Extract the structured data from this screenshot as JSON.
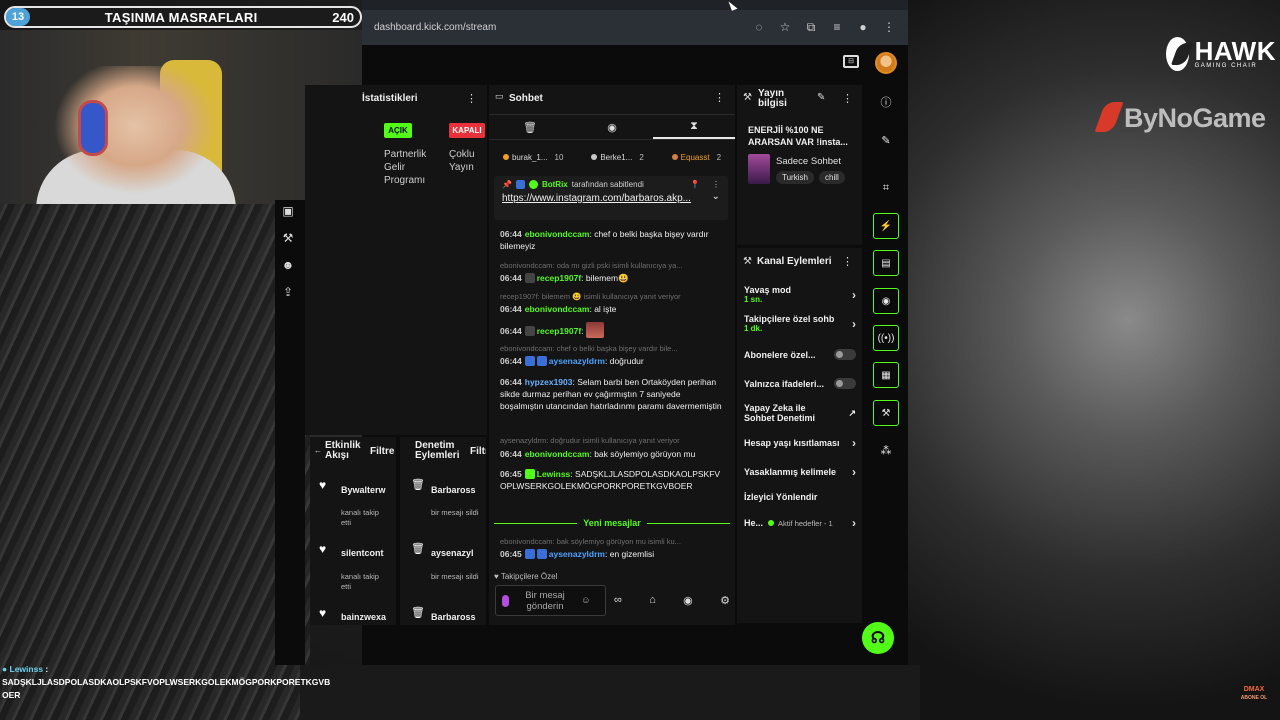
{
  "overlay": {
    "goal_count": "13",
    "goal_title": "TAŞINMA MASRAFLARI",
    "goal_value": "240"
  },
  "browser": {
    "url": "dashboard.kick.com/stream"
  },
  "stats": {
    "title": "İstatistikleri",
    "badge_on": "AÇIK",
    "badge_off": "KAPALI",
    "partner_label": "Partnerlik Gelir Programı",
    "multistream_label": "Çoklu Yayın"
  },
  "chat": {
    "title": "Sohbet",
    "top_chatters": [
      {
        "name": "burak_1...",
        "count": "10",
        "color": "#f0a020"
      },
      {
        "name": "Berke1...",
        "count": "2",
        "color": "#c8c8c8"
      },
      {
        "name": "Equasst",
        "count": "2",
        "color": "#d08040"
      }
    ],
    "pinned": {
      "user": "BotRix",
      "label": "tarafından sabitlendi",
      "link": "https://www.instagram.com/barbaros.akp..."
    },
    "messages": [
      {
        "time": "06:44",
        "user": "ebonivondccam",
        "color": "#53fc18",
        "text": "chef o belki başka bişey vardır bilemeyiz"
      },
      {
        "reply": "ebonivondccam: oda mı gizli pski isimli kullanıcıya ya..."
      },
      {
        "time": "06:44",
        "user": "recep1907f",
        "color": "#53fc18",
        "text": "bilemem😃"
      },
      {
        "reply": "recep1907f: bilemem 😃 isimli kullanıcıya yanıt veriyor"
      },
      {
        "time": "06:44",
        "user": "ebonivondccam",
        "color": "#53fc18",
        "text": "al işte"
      },
      {
        "time": "06:44",
        "user": "recep1907f",
        "color": "#53fc18",
        "text": ""
      },
      {
        "reply": "ebonivondccam: chef o belki başka bişey vardır bile..."
      },
      {
        "time": "06:44",
        "user": "aysenazyldrm",
        "color": "#4aa3ff",
        "text": "doğrudur"
      },
      {
        "time": "06:44",
        "user": "hypzex1903",
        "color": "#6ab0ff",
        "text": "Selam barbi ben Ortaköyden perihan sikde durmaz perihan ev çağırmıştın 7 saniyede boşalmıştın utancından hatırladınmı paramı davermemiştin"
      },
      {
        "reply": "aysenazyldrm: doğrudur isimli kullanıcıya yanıt veriyor"
      },
      {
        "time": "06:44",
        "user": "ebonivondccam",
        "color": "#53fc18",
        "text": "bak söylemiyo görüyon mu"
      },
      {
        "time": "06:45",
        "user": "Lewinss",
        "color": "#53fc18",
        "text": "SADŞKLJLASDPOLASDKAOLPSKFVOPLWSERKGOLEKMÖGPORKPORETKGVBOER"
      },
      {
        "reply": "ebonivondccam: bak söylemiyo görüyon mu isimli ku..."
      },
      {
        "time": "06:45",
        "user": "aysenazyldrm",
        "color": "#4aa3ff",
        "text": "en gizemlisi"
      }
    ],
    "new_messages": "Yeni mesajlar",
    "mode": "Takipçilere Özel",
    "input_placeholder": "Bir mesaj gönderin"
  },
  "stream_info": {
    "title": "Yayın bilgisi",
    "stream_title": "ENERJİİ %100 NE ARARSAN VAR !insta...",
    "category": "Sadece Sohbet",
    "tags": [
      "Turkish",
      "chill"
    ]
  },
  "channel_actions": {
    "title": "Kanal Eylemleri",
    "items": [
      {
        "label": "Yavaş mod",
        "sub": "1 sn."
      },
      {
        "label": "Takipçilere özel sohb",
        "sub": "1 dk."
      },
      {
        "label": "Abonelere özel..."
      },
      {
        "label": "Yalnızca ifadeleri..."
      },
      {
        "label": "Yapay Zeka ile Sohbet Denetimi"
      },
      {
        "label": "Hesap yaşı kısıtlaması"
      },
      {
        "label": "Yasaklanmış kelimele"
      },
      {
        "label": "İzleyici Yönlendir"
      },
      {
        "label": "He...",
        "sub": "Aktif hedefler - 1"
      }
    ]
  },
  "events": {
    "title": "Etkinlik Akışı",
    "filter": "Filtre",
    "items": [
      {
        "user": "Bywalterw",
        "action": "kanalı takip etti"
      },
      {
        "user": "silentcont",
        "action": "kanalı takip etti"
      },
      {
        "user": "bainzwexa",
        "action": ""
      }
    ]
  },
  "moderation": {
    "title": "Denetim Eylemleri",
    "filter": "Filtre",
    "items": [
      {
        "user": "Barbaross",
        "action": "bir mesajı sildi"
      },
      {
        "user": "aysenazyl",
        "action": "bir mesajı sildi"
      },
      {
        "user": "Barbaross",
        "action": ""
      }
    ]
  },
  "overlay_chat": {
    "user": "Lewinss",
    "text": "SADŞKLJLASDPOLASDKAOLPSKFVOPLWSERKGOLEKMÖGPORKPORETKGVBOER"
  },
  "brands": {
    "hawk": "HAWK",
    "hawk_sub": "GAMING CHAIR",
    "bynogame": "ByNoGame",
    "dmax_line1": "DMAX",
    "dmax_line2": "ABONE OL"
  }
}
